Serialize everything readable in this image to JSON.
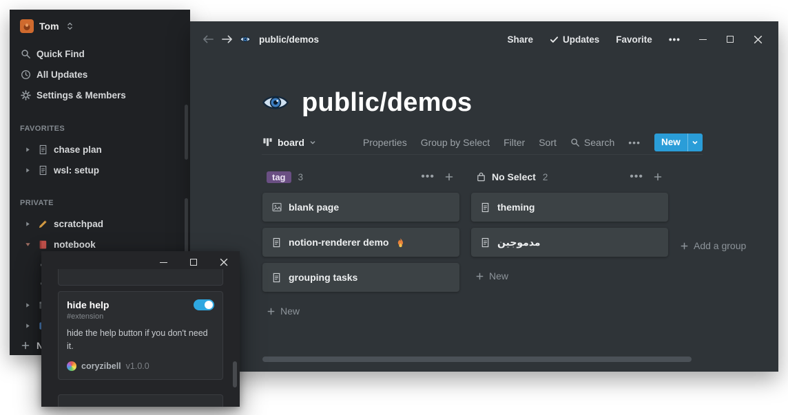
{
  "colors": {
    "main_bg": "#2f3438",
    "sidebar_bg": "#1f2124",
    "card_bg": "#3c4245",
    "accent_blue": "#2a9dd8",
    "toggle_blue": "#2ea7e0",
    "tag_purple": "#6a4f83"
  },
  "glyphs": {
    "more": "•••"
  },
  "sidebar": {
    "workspace_name": "Tom",
    "menu": [
      {
        "label": "Quick Find",
        "icon": "search-icon"
      },
      {
        "label": "All Updates",
        "icon": "clock-icon"
      },
      {
        "label": "Settings & Members",
        "icon": "gear-icon"
      }
    ],
    "favorites_header": "FAVORITES",
    "favorites": [
      {
        "label": "chase plan",
        "icon": "page-icon"
      },
      {
        "label": "wsl: setup",
        "icon": "page-icon"
      }
    ],
    "private_header": "PRIVATE",
    "private": [
      {
        "label": "scratchpad",
        "icon": "pencil-icon"
      },
      {
        "label": "notebook",
        "icon": "red-book-icon",
        "expanded": true
      }
    ],
    "new_page_label": "N"
  },
  "titlebar": {
    "breadcrumb": "public/demos",
    "share_label": "Share",
    "updates_label": "Updates",
    "favorite_label": "Favorite"
  },
  "page": {
    "icon": "eye-icon",
    "title": "public/demos"
  },
  "view_bar": {
    "view_label": "board",
    "menu": [
      "Properties",
      "Group by Select",
      "Filter",
      "Sort"
    ],
    "search_label": "Search",
    "new_button_label": "New"
  },
  "board": {
    "groups": [
      {
        "name": "tag",
        "count": "3",
        "cards": [
          {
            "title": "blank page",
            "icon": "image-icon"
          },
          {
            "title": "notion-renderer demo",
            "icon": "page-icon",
            "emoji": "fire"
          },
          {
            "title": "grouping tasks",
            "icon": "page-icon"
          }
        ],
        "add_card_label": "New"
      },
      {
        "name": "No Select",
        "count": "2",
        "cards": [
          {
            "title": "theming",
            "icon": "page-icon"
          },
          {
            "title": "مدموجين",
            "icon": "page-icon"
          }
        ],
        "add_card_label": "New"
      }
    ],
    "add_group_label": "Add a group"
  },
  "popup": {
    "extension": {
      "title": "hide help",
      "tag": "#extension",
      "description": "hide the help button if you don't need it.",
      "author": "coryzibell",
      "version": "v1.0.0",
      "toggle_on": true
    }
  }
}
